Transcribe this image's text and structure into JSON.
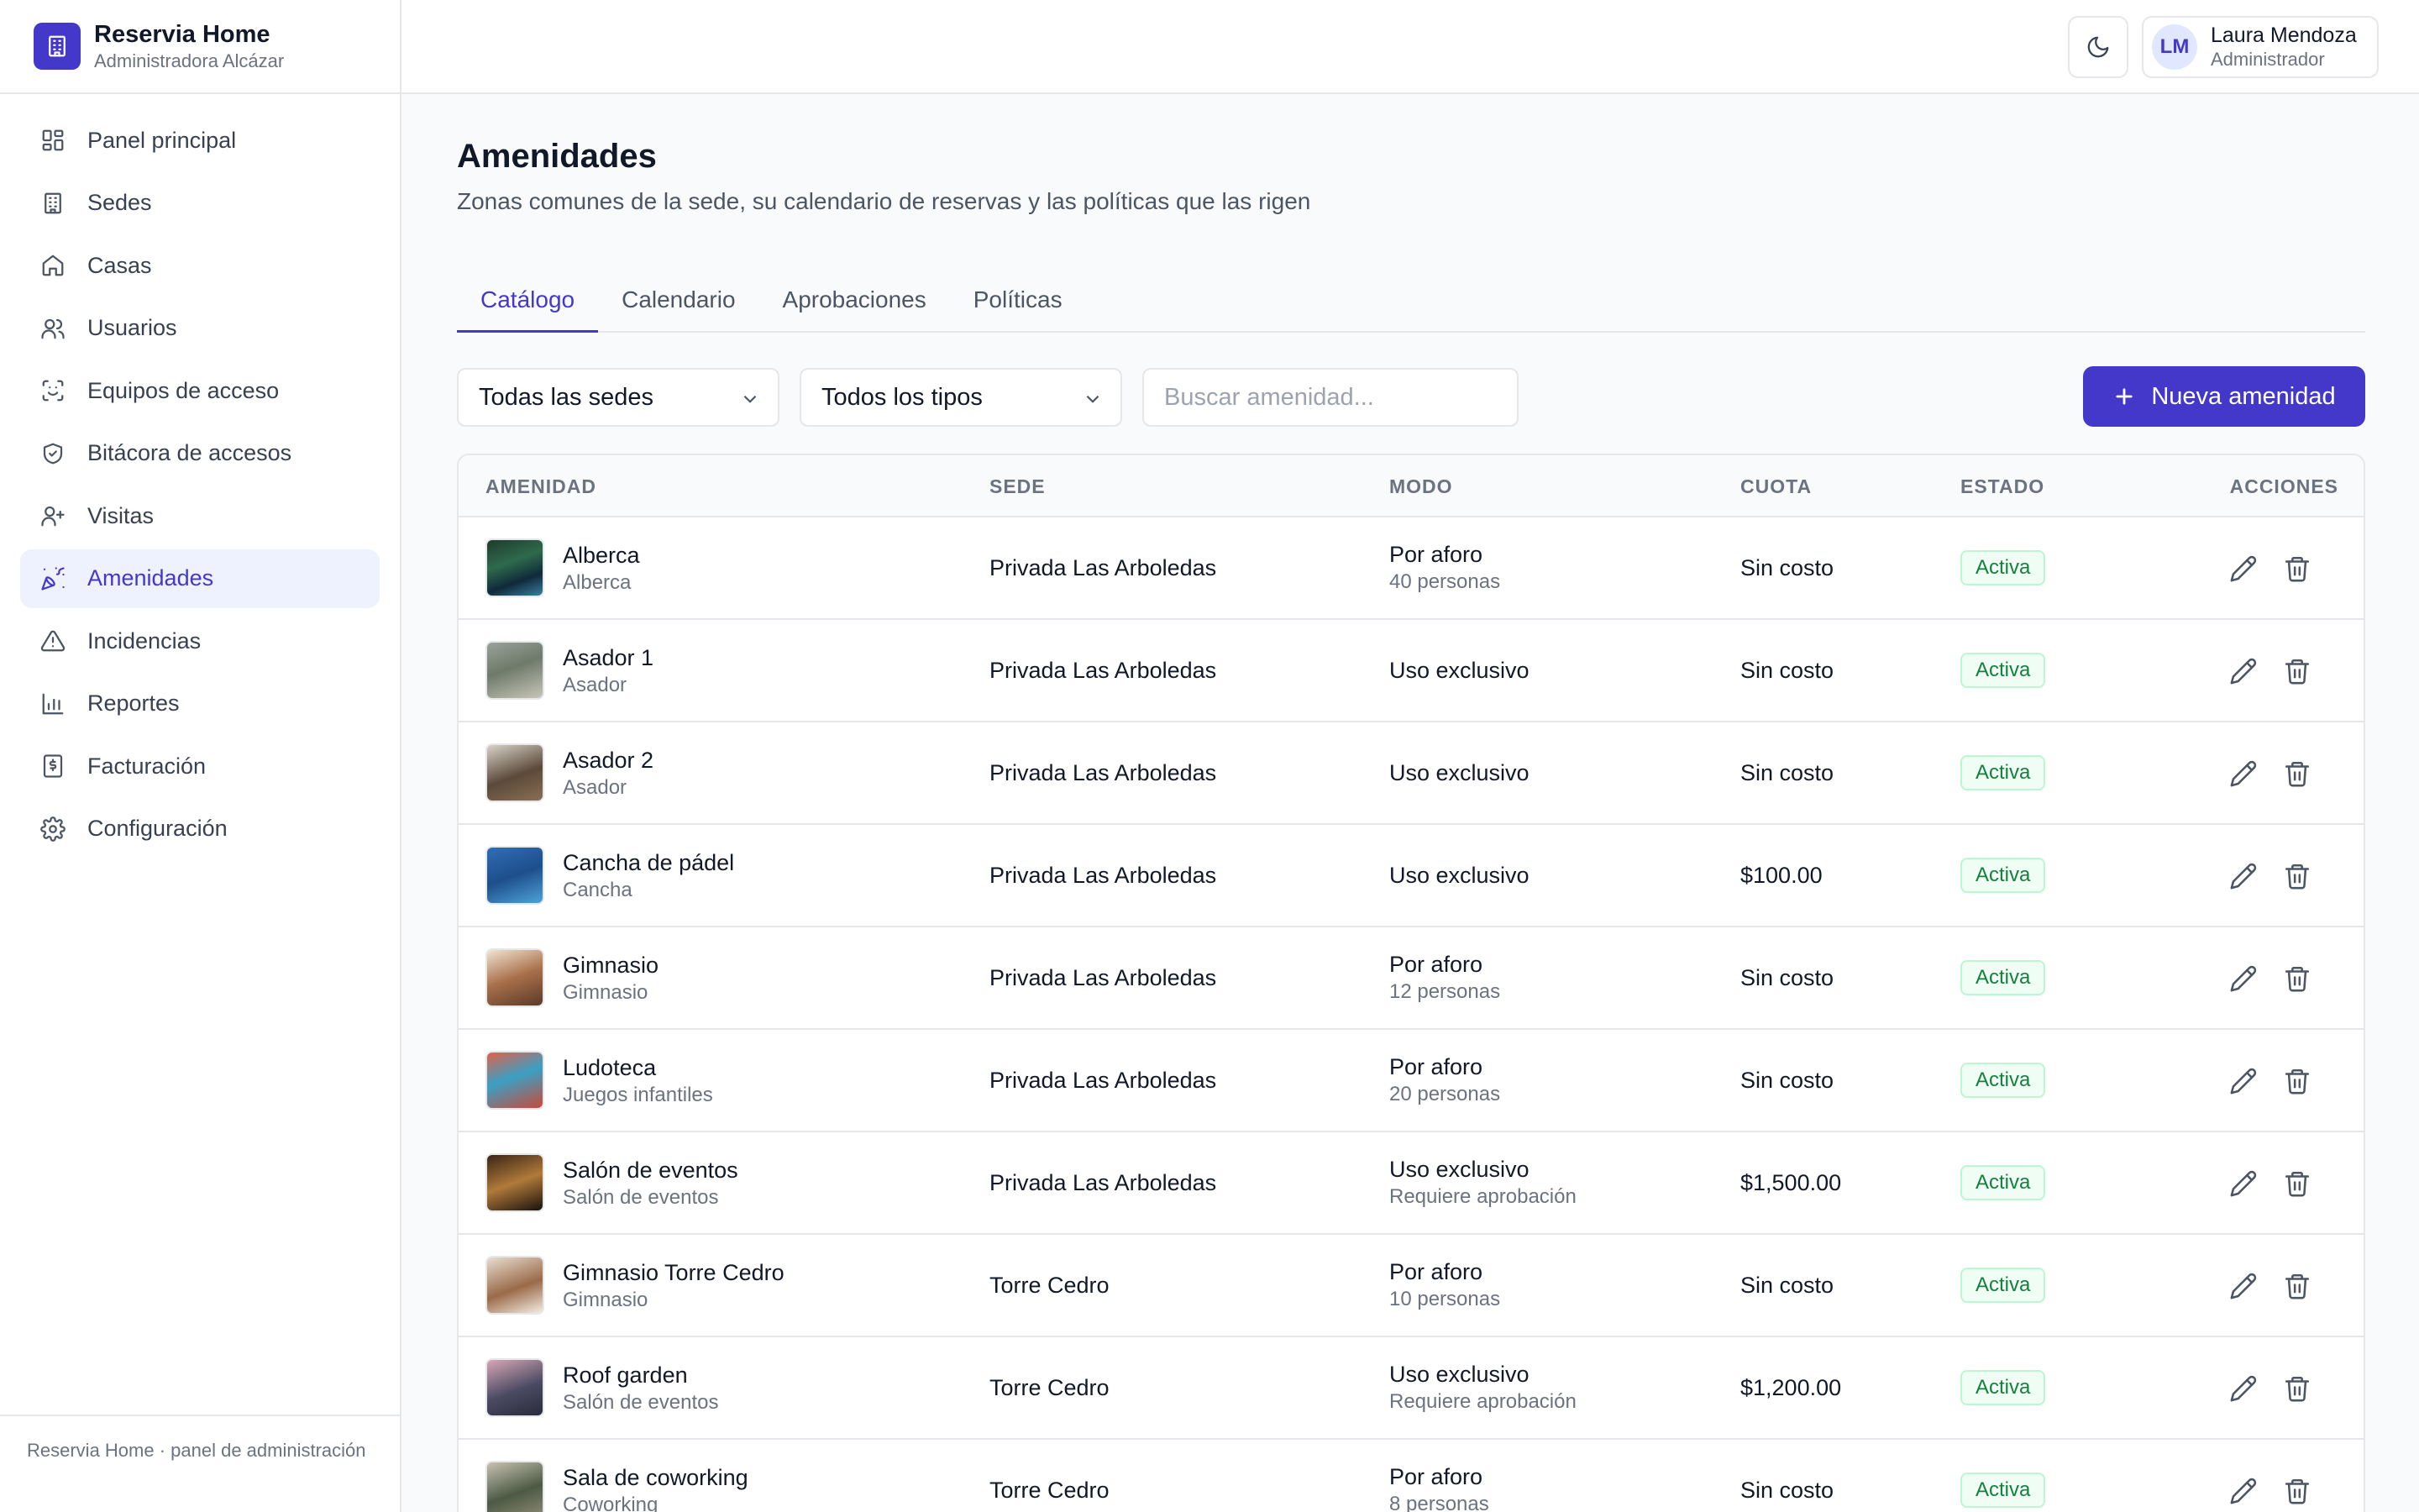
{
  "brand": {
    "title": "Reservia Home",
    "subtitle": "Administradora Alcázar"
  },
  "sidebar": {
    "items": [
      {
        "label": "Panel principal",
        "icon": "dashboard-icon"
      },
      {
        "label": "Sedes",
        "icon": "building-icon"
      },
      {
        "label": "Casas",
        "icon": "home-icon"
      },
      {
        "label": "Usuarios",
        "icon": "users-icon"
      },
      {
        "label": "Equipos de acceso",
        "icon": "scan-icon"
      },
      {
        "label": "Bitácora de accesos",
        "icon": "shield-icon"
      },
      {
        "label": "Visitas",
        "icon": "user-plus-icon"
      },
      {
        "label": "Amenidades",
        "icon": "party-icon",
        "active": true
      },
      {
        "label": "Incidencias",
        "icon": "alert-icon"
      },
      {
        "label": "Reportes",
        "icon": "chart-icon"
      },
      {
        "label": "Facturación",
        "icon": "receipt-icon"
      },
      {
        "label": "Configuración",
        "icon": "gear-icon"
      }
    ],
    "footer": "Reservia Home · panel de administración"
  },
  "topbar": {
    "user_initials": "LM",
    "user_name": "Laura Mendoza",
    "user_role": "Administrador"
  },
  "page": {
    "title": "Amenidades",
    "subtitle": "Zonas comunes de la sede, su calendario de reservas y las políticas que las rigen"
  },
  "tabs": [
    {
      "label": "Catálogo",
      "active": true
    },
    {
      "label": "Calendario"
    },
    {
      "label": "Aprobaciones"
    },
    {
      "label": "Políticas"
    }
  ],
  "filters": {
    "sede_value": "Todas las sedes",
    "tipo_value": "Todos los tipos",
    "search_placeholder": "Buscar amenidad...",
    "new_button": "Nueva amenidad"
  },
  "table": {
    "headers": {
      "amenidad": "AMENIDAD",
      "sede": "SEDE",
      "modo": "MODO",
      "cuota": "CUOTA",
      "estado": "ESTADO",
      "acciones": "ACCIONES"
    },
    "rows": [
      {
        "name": "Alberca",
        "type": "Alberca",
        "sede": "Privada Las Arboledas",
        "mode": "Por aforo",
        "mode_detail": "40 personas",
        "fee": "Sin costo",
        "status": "Activa"
      },
      {
        "name": "Asador 1",
        "type": "Asador",
        "sede": "Privada Las Arboledas",
        "mode": "Uso exclusivo",
        "mode_detail": "",
        "fee": "Sin costo",
        "status": "Activa"
      },
      {
        "name": "Asador 2",
        "type": "Asador",
        "sede": "Privada Las Arboledas",
        "mode": "Uso exclusivo",
        "mode_detail": "",
        "fee": "Sin costo",
        "status": "Activa"
      },
      {
        "name": "Cancha de pádel",
        "type": "Cancha",
        "sede": "Privada Las Arboledas",
        "mode": "Uso exclusivo",
        "mode_detail": "",
        "fee": "$100.00",
        "status": "Activa"
      },
      {
        "name": "Gimnasio",
        "type": "Gimnasio",
        "sede": "Privada Las Arboledas",
        "mode": "Por aforo",
        "mode_detail": "12 personas",
        "fee": "Sin costo",
        "status": "Activa"
      },
      {
        "name": "Ludoteca",
        "type": "Juegos infantiles",
        "sede": "Privada Las Arboledas",
        "mode": "Por aforo",
        "mode_detail": "20 personas",
        "fee": "Sin costo",
        "status": "Activa"
      },
      {
        "name": "Salón de eventos",
        "type": "Salón de eventos",
        "sede": "Privada Las Arboledas",
        "mode": "Uso exclusivo",
        "mode_detail": "Requiere aprobación",
        "fee": "$1,500.00",
        "status": "Activa"
      },
      {
        "name": "Gimnasio Torre Cedro",
        "type": "Gimnasio",
        "sede": "Torre Cedro",
        "mode": "Por aforo",
        "mode_detail": "10 personas",
        "fee": "Sin costo",
        "status": "Activa"
      },
      {
        "name": "Roof garden",
        "type": "Salón de eventos",
        "sede": "Torre Cedro",
        "mode": "Uso exclusivo",
        "mode_detail": "Requiere aprobación",
        "fee": "$1,200.00",
        "status": "Activa"
      },
      {
        "name": "Sala de coworking",
        "type": "Coworking",
        "sede": "Torre Cedro",
        "mode": "Por aforo",
        "mode_detail": "8 personas",
        "fee": "Sin costo",
        "status": "Activa"
      }
    ]
  },
  "colors": {
    "accent": "#4338ca",
    "active_bg": "#eef2ff",
    "badge_text": "#15803d",
    "badge_bg": "#f0fdf4"
  }
}
